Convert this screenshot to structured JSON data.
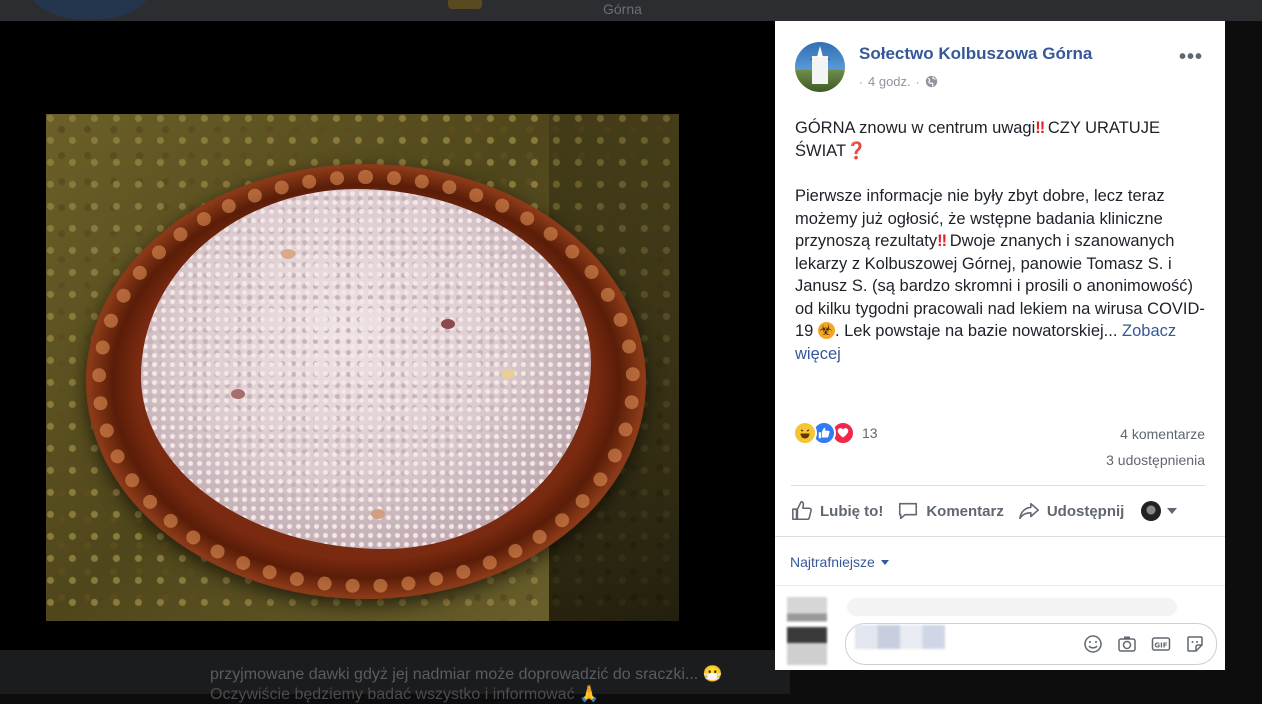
{
  "background": {
    "top_word": "Górna",
    "bottom_line1": "przyjmowane dawki gdyż jej nadmiar może doprowadzić do sraczki... 😷",
    "bottom_line2": "Oczywiście będziemy badać wszystko i informować 🙏"
  },
  "post": {
    "page_name": "Sołectwo Kolbuszowa Górna",
    "time": "4 godz.",
    "time_separator": "·",
    "privacy_icon": "globe-icon",
    "more_label": "•••",
    "headline_a": "GÓRNA znowu w centrum uwagi",
    "headline_b": " CZY URATUJE ŚWIAT",
    "double_exclamation": "‼",
    "red_question": "❓",
    "body_a": "Pierwsze informacje nie były zbyt dobre, lecz teraz możemy już ogłosić, że wstępne badania kliniczne przynoszą rezultaty",
    "body_b": " Dwoje znanych i szanowanych lekarzy z Kolbuszowej Górnej, panowie Tomasz S. i Janusz S. (są bardzo skromni i prosili o anonimowość) od kilku tygodni pracowali nad lekiem na wirusa COVID-19 ",
    "body_c": ". Lek powstaje na bazie nowatorskiej...",
    "see_more": "Zobacz więcej"
  },
  "stats": {
    "reaction_count": "13",
    "reactions": [
      "haha",
      "like",
      "love"
    ],
    "comments": "4 komentarze",
    "shares": "3 udostępnienia"
  },
  "actions": {
    "like": "Lubię to!",
    "comment": "Komentarz",
    "share": "Udostępnij"
  },
  "comments": {
    "sort_label": "Najtrafniejsze",
    "input_placeholder": "ntarz..."
  },
  "colors": {
    "link": "#365899",
    "meta": "#90949c",
    "text": "#1d2129",
    "action": "#606770"
  }
}
